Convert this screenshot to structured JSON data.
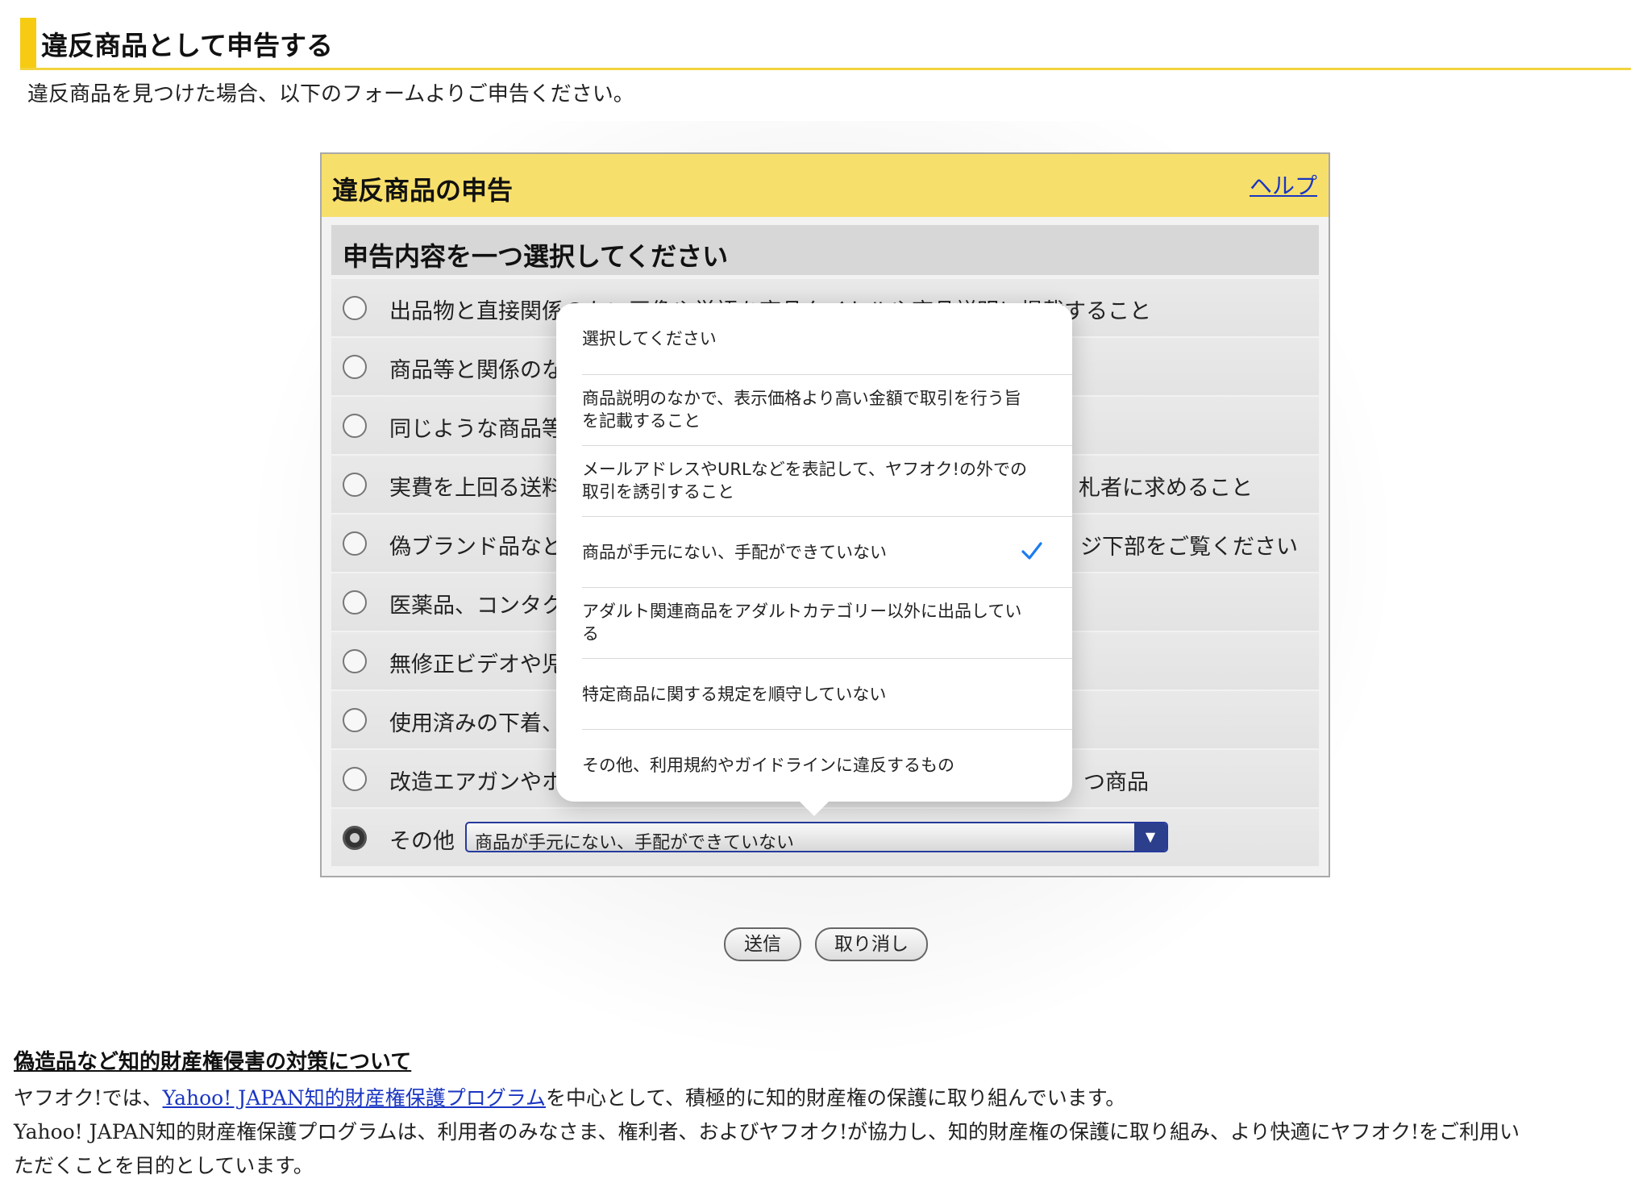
{
  "page": {
    "heading": "違反商品として申告する",
    "lead": "違反商品を見つけた場合、以下のフォームよりご申告ください。"
  },
  "panel": {
    "title": "違反商品の申告",
    "help": "ヘルプ",
    "section_title": "申告内容を一つ選択してください",
    "options": [
      {
        "left": "出品物と直接関係のない画像や単語を商品タイトルや商品説明に掲載すること",
        "right": ""
      },
      {
        "left": "商品等と関係のな",
        "right": ""
      },
      {
        "left": "同じような商品等",
        "right": ""
      },
      {
        "left": "実費を上回る送料",
        "right": "札者に求めること"
      },
      {
        "left": "偽ブランド品など",
        "right": "ジ下部をご覧ください"
      },
      {
        "left": "医薬品、コンタク",
        "right": ""
      },
      {
        "left": "無修正ビデオや児",
        "right": ""
      },
      {
        "left": "使用済みの下着、",
        "right": ""
      },
      {
        "left": "改造エアガンやホ",
        "right": "つ商品"
      }
    ],
    "other": {
      "label": "その他",
      "selected": "商品が手元にない、手配ができていない"
    }
  },
  "buttons": {
    "submit": "送信",
    "cancel": "取り消し"
  },
  "dropdown": {
    "items": [
      {
        "text": "選択してください",
        "checked": false
      },
      {
        "text": "商品説明のなかで、表示価格より高い金額で取引を行う旨を記載すること",
        "checked": false
      },
      {
        "text": "メールアドレスやURLなどを表記して、ヤフオク!の外での取引を誘引すること",
        "checked": false
      },
      {
        "text": "商品が手元にない、手配ができていない",
        "checked": true
      },
      {
        "text": "アダルト関連商品をアダルトカテゴリー以外に出品している",
        "checked": false
      },
      {
        "text": "特定商品に関する規定を順守していない",
        "checked": false
      },
      {
        "text": "その他、利用規約やガイドラインに違反するもの",
        "checked": false
      }
    ]
  },
  "footer": {
    "title": "偽造品など知的財産権侵害の対策について",
    "line1_pre": "ヤフオク!では、",
    "line1_link": "Yahoo! JAPAN知的財産権保護プログラム",
    "line1_post": "を中心として、積極的に知的財産権の保護に取り組んでいます。",
    "line2": "Yahoo! JAPAN知的財産権保護プログラムは、利用者のみなさま、権利者、およびヤフオク!が協力し、知的財産権の保護に取り組み、より快適にヤフオク!をご利用い",
    "line3": "ただくことを目的としています。"
  },
  "colors": {
    "accent_yellow": "#f6cb12",
    "panel_header": "#f7df6b",
    "link_blue": "#1a36c2",
    "check_blue": "#1a7cf0",
    "select_border": "#263a9c"
  }
}
